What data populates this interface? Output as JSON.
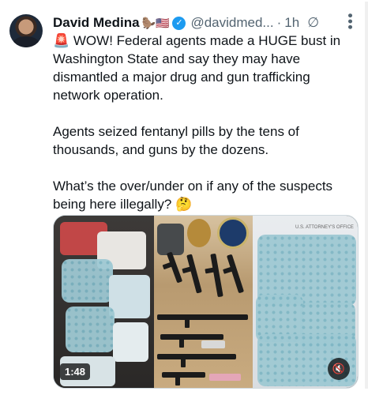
{
  "author": {
    "name": "David Medina",
    "emoji": "🦫🇺🇸",
    "verified_mark": "✓",
    "handle": "@davidmed...",
    "separator": "·",
    "time": "1h",
    "grok_icon": "∅",
    "more_icon": "•••"
  },
  "tweet": {
    "paragraph1": "🚨 WOW! Federal agents made a HUGE bust in Washington State and say they may have dismantled a major drug and gun trafficking network operation.",
    "paragraph2": "Agents seized fentanyl pills by the tens of thousands, and guns by the dozens.",
    "paragraph3": "What’s the over/under on if any of the suspects being here illegally? 🤔"
  },
  "media": {
    "duration": "1:48",
    "mute_icon": "🔇",
    "panel3_label": "U.S. ATTORNEY'S OFFICE",
    "colors": {
      "pill_blue": "#9fc9d3",
      "overlay": "#000000"
    }
  }
}
